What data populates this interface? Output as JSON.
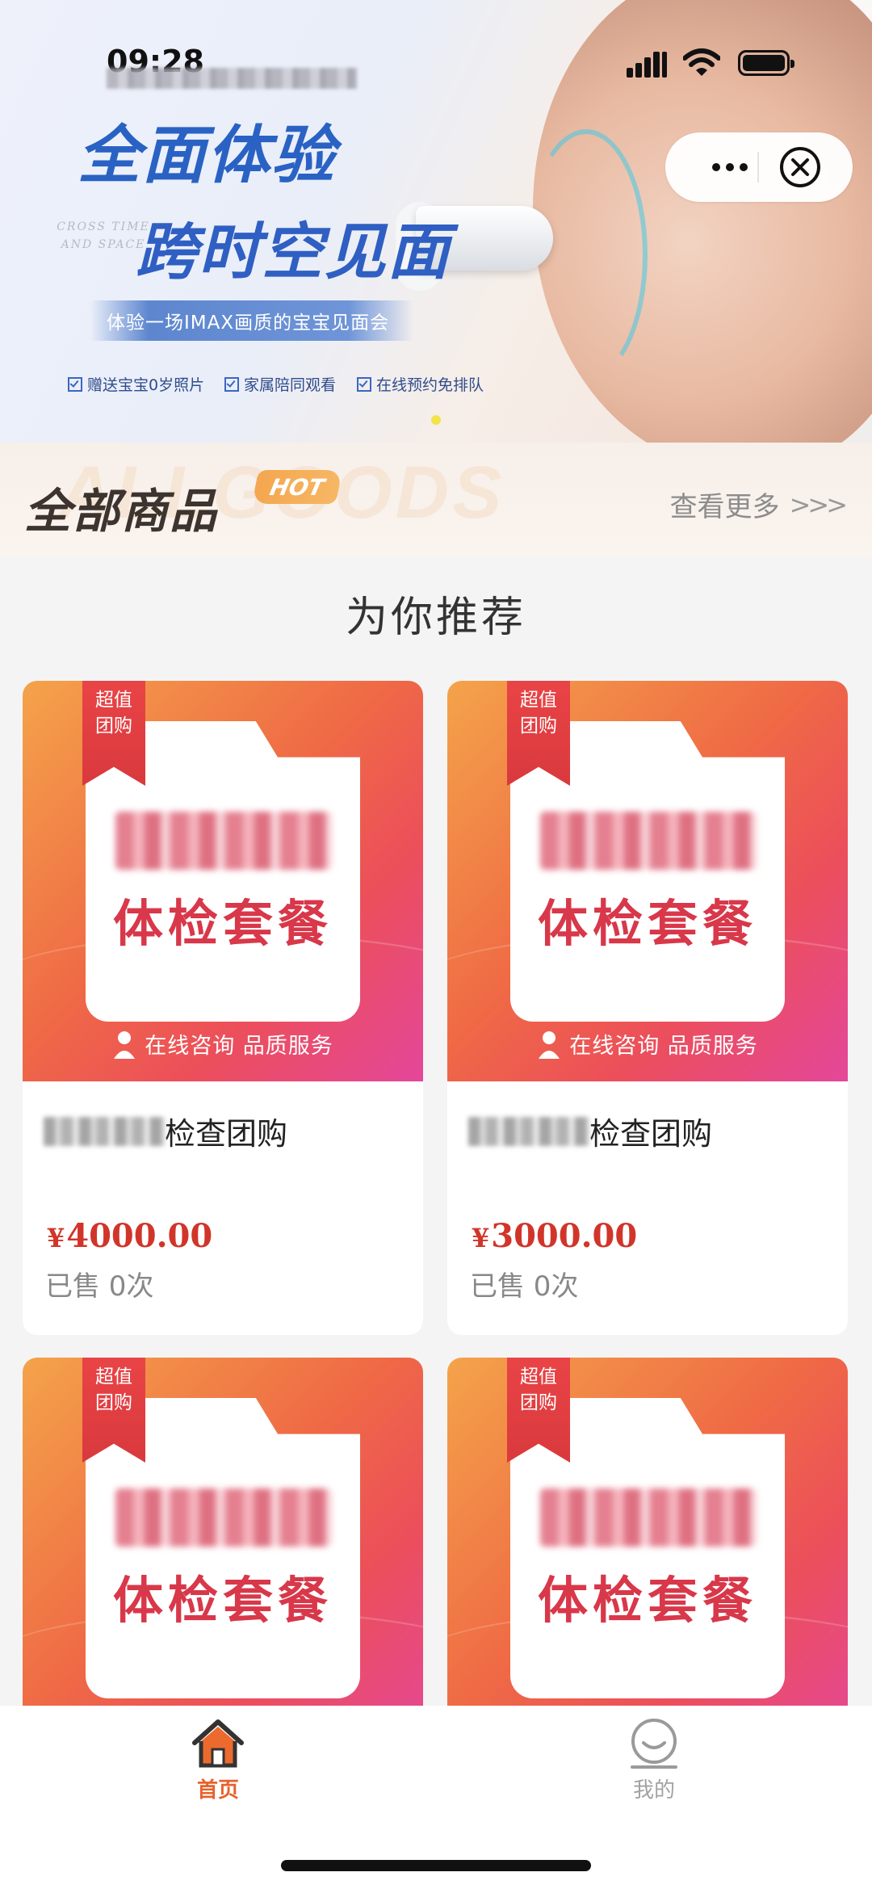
{
  "status_bar": {
    "time": "09:28"
  },
  "capsule": {
    "more_icon": "more-dots-icon",
    "close_icon": "close-circle-icon"
  },
  "banner": {
    "headline_line1": "全面体验",
    "headline_line2": "跨时空见面",
    "cross_time": "CROSS TIME AND SPACE",
    "tagline": "体验一场IMAX画质的宝宝见面会",
    "features": [
      "赠送宝宝0岁照片",
      "家属陪同观看",
      "在线预约免排队"
    ]
  },
  "goods_header": {
    "background_word": "ALLGOODS",
    "title": "全部商品",
    "badge": "HOT",
    "view_more": "查看更多",
    "view_more_arrows": ">>>"
  },
  "section_title": "为你推荐",
  "products": [
    {
      "ribbon_line1": "超值",
      "ribbon_line2": "团购",
      "package_text": "体检套餐",
      "consult_text": "在线咨询 品质服务",
      "name_suffix": "检查团购",
      "currency": "¥",
      "price": "4000.00",
      "sold": "已售 0次"
    },
    {
      "ribbon_line1": "超值",
      "ribbon_line2": "团购",
      "package_text": "体检套餐",
      "consult_text": "在线咨询 品质服务",
      "name_suffix": "检查团购",
      "currency": "¥",
      "price": "3000.00",
      "sold": "已售 0次"
    },
    {
      "ribbon_line1": "超值",
      "ribbon_line2": "团购",
      "package_text": "体检套餐"
    },
    {
      "ribbon_line1": "超值",
      "ribbon_line2": "团购",
      "package_text": "体检套餐"
    }
  ],
  "tabbar": {
    "home": {
      "label": "首页",
      "icon": "home-icon"
    },
    "me": {
      "label": "我的",
      "icon": "profile-icon"
    }
  },
  "colors": {
    "price": "#d1352a",
    "tab_active": "#e6622d",
    "tab_inactive": "#a2a2a2",
    "card_gradient_start": "#f4a34a",
    "card_gradient_end": "#e4479a"
  }
}
